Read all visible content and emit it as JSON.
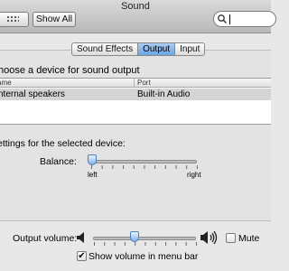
{
  "window": {
    "title": "Sound"
  },
  "toolbar": {
    "show_all_label": "Show All",
    "search": {
      "value": "",
      "placeholder": ""
    }
  },
  "tabs": [
    {
      "label": "Sound Effects",
      "active": false
    },
    {
      "label": "Output",
      "active": true
    },
    {
      "label": "Input",
      "active": false
    }
  ],
  "output": {
    "heading": "hoose a device for sound output",
    "columns": {
      "name": "ame",
      "port": "Port"
    },
    "rows": [
      {
        "name": "nternal speakers",
        "port": "Built-in Audio",
        "selected": true
      }
    ],
    "settings_heading": "ettings for the selected device:",
    "balance": {
      "label": "Balance:",
      "left": "left",
      "right": "right",
      "value": 0.0
    }
  },
  "volume": {
    "label": "Output volume:",
    "value": 0.4,
    "mute_label": "Mute",
    "mute_checked": false,
    "show_in_menu_label": "Show volume in menu bar",
    "show_in_menu_checked": true
  },
  "colors": {
    "accent": "#6ea4e3",
    "selection": "#d4d4d4"
  }
}
